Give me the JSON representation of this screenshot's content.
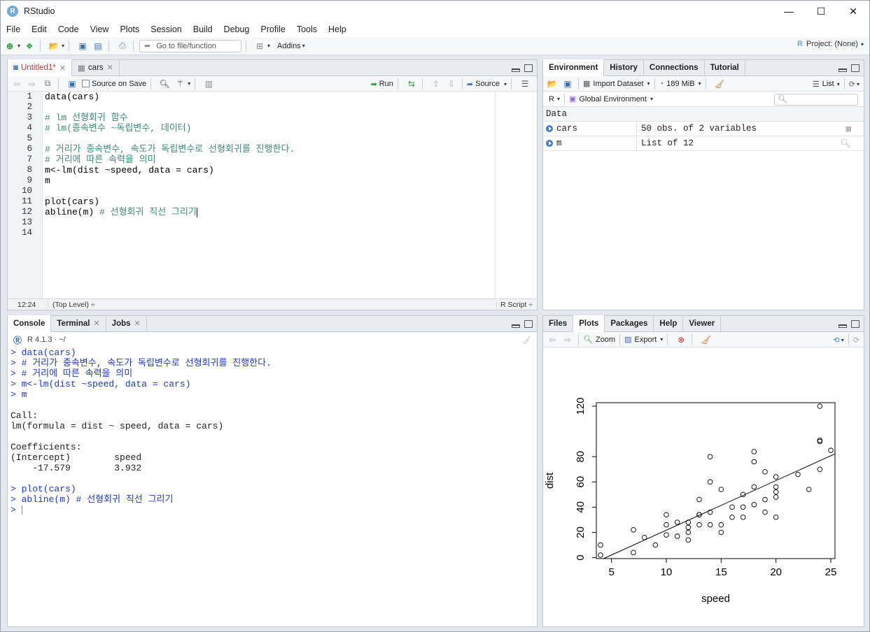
{
  "window": {
    "title": "RStudio",
    "app_icon": "R"
  },
  "menu": [
    "File",
    "Edit",
    "Code",
    "View",
    "Plots",
    "Session",
    "Build",
    "Debug",
    "Profile",
    "Tools",
    "Help"
  ],
  "toolbar": {
    "goto_placeholder": "Go to file/function",
    "addins": "Addins",
    "project": "Project: (None)"
  },
  "source": {
    "tabs": [
      {
        "label": "Untitled1*",
        "active": true,
        "modified": true
      },
      {
        "label": "cars",
        "active": false
      }
    ],
    "source_on_save": "Source on Save",
    "run": "Run",
    "source_btn": "Source",
    "line_numbers": [
      "1",
      "2",
      "3",
      "4",
      "5",
      "6",
      "7",
      "8",
      "9",
      "10",
      "11",
      "12",
      "13",
      "14"
    ],
    "lines": [
      {
        "text": "data(cars)",
        "type": "code"
      },
      {
        "text": "",
        "type": "code"
      },
      {
        "text": "# lm 선형회귀 함수",
        "type": "cmt"
      },
      {
        "text": "# lm(종속변수 ~독립변수, 데이터)",
        "type": "cmt"
      },
      {
        "text": "",
        "type": "code"
      },
      {
        "text": "# 거리가 종속변수, 속도가 독립변수로 선형회귀를 진행한다.",
        "type": "cmt"
      },
      {
        "text": "# 거리에 따른 속력을 의미",
        "type": "cmt"
      },
      {
        "text": "m<-lm(dist ~speed, data = cars)",
        "type": "code"
      },
      {
        "text": "m",
        "type": "code"
      },
      {
        "text": "",
        "type": "code"
      },
      {
        "text": "plot(cars)",
        "type": "code"
      },
      {
        "text": "abline(m) ",
        "type": "code",
        "cmt": "# 선형회귀 직선 그리기"
      },
      {
        "text": "",
        "type": "code"
      },
      {
        "text": "",
        "type": "code"
      }
    ],
    "status_pos": "12:24",
    "status_scope": "(Top Level) ÷",
    "status_type": "R Script ÷"
  },
  "console": {
    "tabs": [
      "Console",
      "Terminal",
      "Jobs"
    ],
    "version": "R 4.1.3 · ~/",
    "lines": [
      {
        "text": "> data(cars)",
        "in": true
      },
      {
        "text": "> # 거리가 종속변수, 속도가 독립변수로 선형회귀를 진행한다.",
        "in": true
      },
      {
        "text": "> # 거리에 따른 속력을 의미",
        "in": true
      },
      {
        "text": "> m<-lm(dist ~speed, data = cars)",
        "in": true
      },
      {
        "text": "> m",
        "in": true
      },
      {
        "text": "",
        "in": false
      },
      {
        "text": "Call:",
        "in": false
      },
      {
        "text": "lm(formula = dist ~ speed, data = cars)",
        "in": false
      },
      {
        "text": "",
        "in": false
      },
      {
        "text": "Coefficients:",
        "in": false
      },
      {
        "text": "(Intercept)        speed  ",
        "in": false
      },
      {
        "text": "    -17.579        3.932  ",
        "in": false
      },
      {
        "text": "",
        "in": false
      },
      {
        "text": "> plot(cars)",
        "in": true
      },
      {
        "text": "> abline(m) # 선형회귀 직선 그리기",
        "in": true
      },
      {
        "text": "> ",
        "in": true
      }
    ]
  },
  "environment": {
    "tabs": [
      "Environment",
      "History",
      "Connections",
      "Tutorial"
    ],
    "import": "Import Dataset",
    "memory": "189 MiB",
    "view": "List",
    "lang": "R",
    "scope": "Global Environment",
    "section": "Data",
    "rows": [
      {
        "name": "cars",
        "value": "50 obs. of 2 variables"
      },
      {
        "name": "m",
        "value": "List of  12"
      }
    ]
  },
  "plots_pane": {
    "tabs": [
      "Files",
      "Plots",
      "Packages",
      "Help",
      "Viewer"
    ],
    "zoom": "Zoom",
    "export": "Export"
  },
  "chart_data": {
    "type": "scatter",
    "xlabel": "speed",
    "ylabel": "dist",
    "xticks": [
      5,
      10,
      15,
      20,
      25
    ],
    "yticks": [
      0,
      20,
      40,
      60,
      80,
      120
    ],
    "xlim": [
      4,
      25
    ],
    "ylim": [
      2,
      120
    ],
    "points": [
      [
        4,
        2
      ],
      [
        4,
        10
      ],
      [
        7,
        4
      ],
      [
        7,
        22
      ],
      [
        8,
        16
      ],
      [
        9,
        10
      ],
      [
        10,
        18
      ],
      [
        10,
        26
      ],
      [
        10,
        34
      ],
      [
        11,
        17
      ],
      [
        11,
        28
      ],
      [
        12,
        14
      ],
      [
        12,
        20
      ],
      [
        12,
        24
      ],
      [
        12,
        28
      ],
      [
        13,
        26
      ],
      [
        13,
        34
      ],
      [
        13,
        34
      ],
      [
        13,
        46
      ],
      [
        14,
        26
      ],
      [
        14,
        36
      ],
      [
        14,
        60
      ],
      [
        14,
        80
      ],
      [
        15,
        20
      ],
      [
        15,
        26
      ],
      [
        15,
        54
      ],
      [
        16,
        32
      ],
      [
        16,
        40
      ],
      [
        17,
        32
      ],
      [
        17,
        40
      ],
      [
        17,
        50
      ],
      [
        18,
        42
      ],
      [
        18,
        56
      ],
      [
        18,
        76
      ],
      [
        18,
        84
      ],
      [
        19,
        36
      ],
      [
        19,
        46
      ],
      [
        19,
        68
      ],
      [
        20,
        32
      ],
      [
        20,
        48
      ],
      [
        20,
        52
      ],
      [
        20,
        56
      ],
      [
        20,
        64
      ],
      [
        22,
        66
      ],
      [
        23,
        54
      ],
      [
        24,
        70
      ],
      [
        24,
        92
      ],
      [
        24,
        93
      ],
      [
        24,
        120
      ],
      [
        25,
        85
      ]
    ],
    "regression": {
      "intercept": -17.579,
      "slope": 3.932
    }
  }
}
